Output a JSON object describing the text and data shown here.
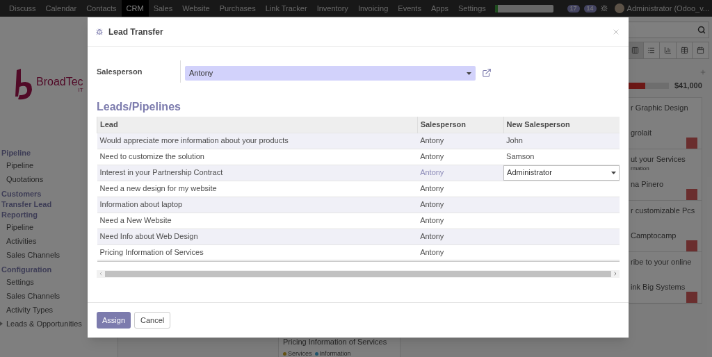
{
  "nav": {
    "items": [
      {
        "label": "Discuss",
        "selected": false
      },
      {
        "label": "Calendar",
        "selected": false
      },
      {
        "label": "Contacts",
        "selected": false
      },
      {
        "label": "CRM",
        "selected": true
      },
      {
        "label": "Sales",
        "selected": false
      },
      {
        "label": "Website",
        "selected": false
      },
      {
        "label": "Purchases",
        "selected": false
      },
      {
        "label": "Link Tracker",
        "selected": false
      },
      {
        "label": "Inventory",
        "selected": false
      },
      {
        "label": "Invoicing",
        "selected": false
      },
      {
        "label": "Events",
        "selected": false
      },
      {
        "label": "Apps",
        "selected": false
      },
      {
        "label": "Settings",
        "selected": false
      }
    ],
    "badges": [
      "17",
      "14"
    ],
    "user": "Administrator (Odoo_v..."
  },
  "sidebar": {
    "logo_text": "BroadTec",
    "logo_subtext": "IT",
    "sections": [
      {
        "title": "Pipeline",
        "items": [
          {
            "label": "Pipeline",
            "kind": "leaf"
          },
          {
            "label": "Quotations",
            "kind": "leaf"
          }
        ]
      },
      {
        "title": "Customers"
      },
      {
        "title": "Transfer Lead"
      },
      {
        "title": "Reporting",
        "items": [
          {
            "label": "Pipeline",
            "kind": "leaf"
          },
          {
            "label": "Activities",
            "kind": "leaf"
          },
          {
            "label": "Sales Channels",
            "kind": "leaf"
          }
        ]
      },
      {
        "title": "Configuration",
        "items": [
          {
            "label": "Settings",
            "kind": "leaf"
          },
          {
            "label": "Sales Channels",
            "kind": "leaf"
          },
          {
            "label": "Activity Types",
            "kind": "leaf"
          },
          {
            "label": "Leads & Opportunities",
            "kind": "folder"
          }
        ]
      }
    ]
  },
  "kanban": {
    "total": "$41,000",
    "level": 0.45,
    "cards": [
      {
        "title": "r Graphic Design",
        "customer": "grolait"
      },
      {
        "title": "ut your Services",
        "tag": "rmation",
        "customer": "na Pinero"
      },
      {
        "title": "r customizable Pcs",
        "customer": "Camptocamp"
      },
      {
        "title": "ribe to your online",
        "customer": "ink Big Systems"
      }
    ],
    "bottom_card": {
      "title": "Pricing Information of Services",
      "tags": [
        {
          "label": "Services",
          "color": "#645113"
        },
        {
          "label": "Information",
          "color": "#1f536b"
        }
      ]
    }
  },
  "dialog": {
    "title": "Lead Transfer",
    "salesperson_label": "Salesperson",
    "salesperson_value": "Antony",
    "section_title": "Leads/Pipelines",
    "columns": [
      "Lead",
      "Salesperson",
      "New Salesperson"
    ],
    "rows": [
      {
        "lead": "Would appreciate more information about your products",
        "salesperson": "Antony",
        "new_salesperson": "John",
        "editing": false
      },
      {
        "lead": "Need to customize the solution",
        "salesperson": "Antony",
        "new_salesperson": "Samson",
        "editing": false
      },
      {
        "lead": "Interest in your Partnership Contract",
        "salesperson": "Antony",
        "new_salesperson": "Administrator",
        "editing": true
      },
      {
        "lead": "Need a new design for my website",
        "salesperson": "Antony",
        "editing": false
      },
      {
        "lead": "Information about laptop",
        "salesperson": "Antony",
        "editing": false
      },
      {
        "lead": "Need a New Website",
        "salesperson": "Antony",
        "editing": false
      },
      {
        "lead": "Need Info about Web Design",
        "salesperson": "Antony",
        "editing": false
      },
      {
        "lead": "Pricing Information of Services",
        "salesperson": "Antony",
        "editing": false
      }
    ],
    "buttons": [
      {
        "label": "Assign",
        "kind": "primary"
      },
      {
        "label": "Cancel",
        "kind": "secondary"
      }
    ]
  }
}
